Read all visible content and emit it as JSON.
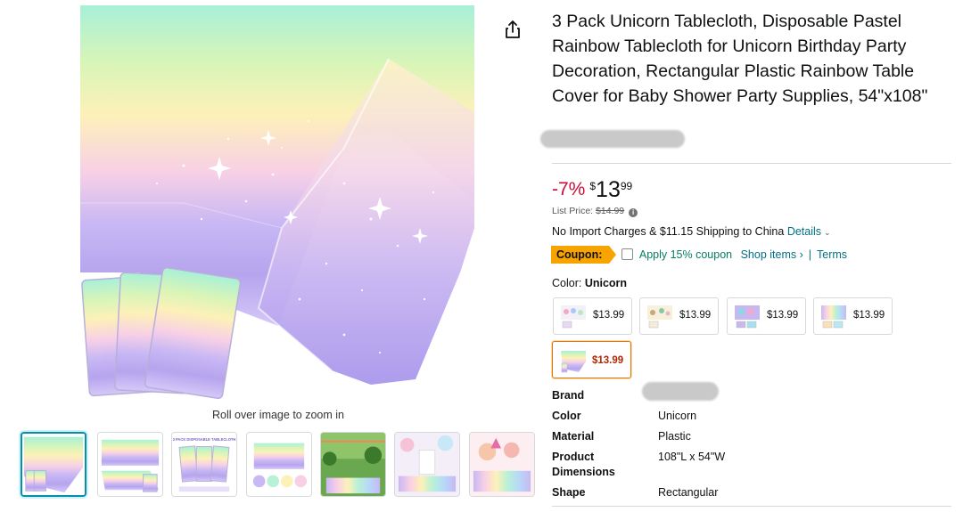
{
  "product": {
    "title": "3 Pack Unicorn Tablecloth, Disposable Pastel Rainbow Tablecloth for Unicorn Birthday Party Decoration, Rectangular Plastic Rainbow Table Cover for Baby Shower Party Supplies, 54\"x108\""
  },
  "gallery": {
    "zoom_hint": "Roll over image to zoom in",
    "thumbnails": [
      "thumb-1",
      "thumb-2",
      "thumb-3",
      "thumb-4",
      "thumb-5",
      "thumb-6",
      "thumb-7"
    ],
    "thumb3_text": "3 PACK DISPOSABLE TABLECLOTH"
  },
  "price": {
    "discount": "-7%",
    "symbol": "$",
    "whole": "13",
    "fraction": "99",
    "list_label": "List Price:",
    "list_value": "$14.99"
  },
  "shipping": {
    "text": "No Import Charges & $11.15 Shipping to China",
    "details_link": "Details"
  },
  "coupon": {
    "badge": "Coupon:",
    "label": "Apply 15% coupon",
    "shop_link": "Shop items ›",
    "separator": "|",
    "terms_link": "Terms"
  },
  "color": {
    "label": "Color:",
    "selected": "Unicorn",
    "swatches": [
      {
        "price": "$13.99"
      },
      {
        "price": "$13.99"
      },
      {
        "price": "$13.99"
      },
      {
        "price": "$13.99"
      },
      {
        "price": "$13.99"
      }
    ]
  },
  "specs": [
    {
      "key": "Brand",
      "value": ""
    },
    {
      "key": "Color",
      "value": "Unicorn"
    },
    {
      "key": "Material",
      "value": "Plastic"
    },
    {
      "key": "Product Dimensions",
      "value": "108\"L x 54\"W"
    },
    {
      "key": "Shape",
      "value": "Rectangular"
    }
  ],
  "colors": {
    "link": "#007185",
    "discount": "#cc0c39",
    "coupon_badge": "#f7a300",
    "coupon_text": "#067d62",
    "selected_border": "#e77600",
    "selected_thumb_border": "#0a8ea8"
  }
}
